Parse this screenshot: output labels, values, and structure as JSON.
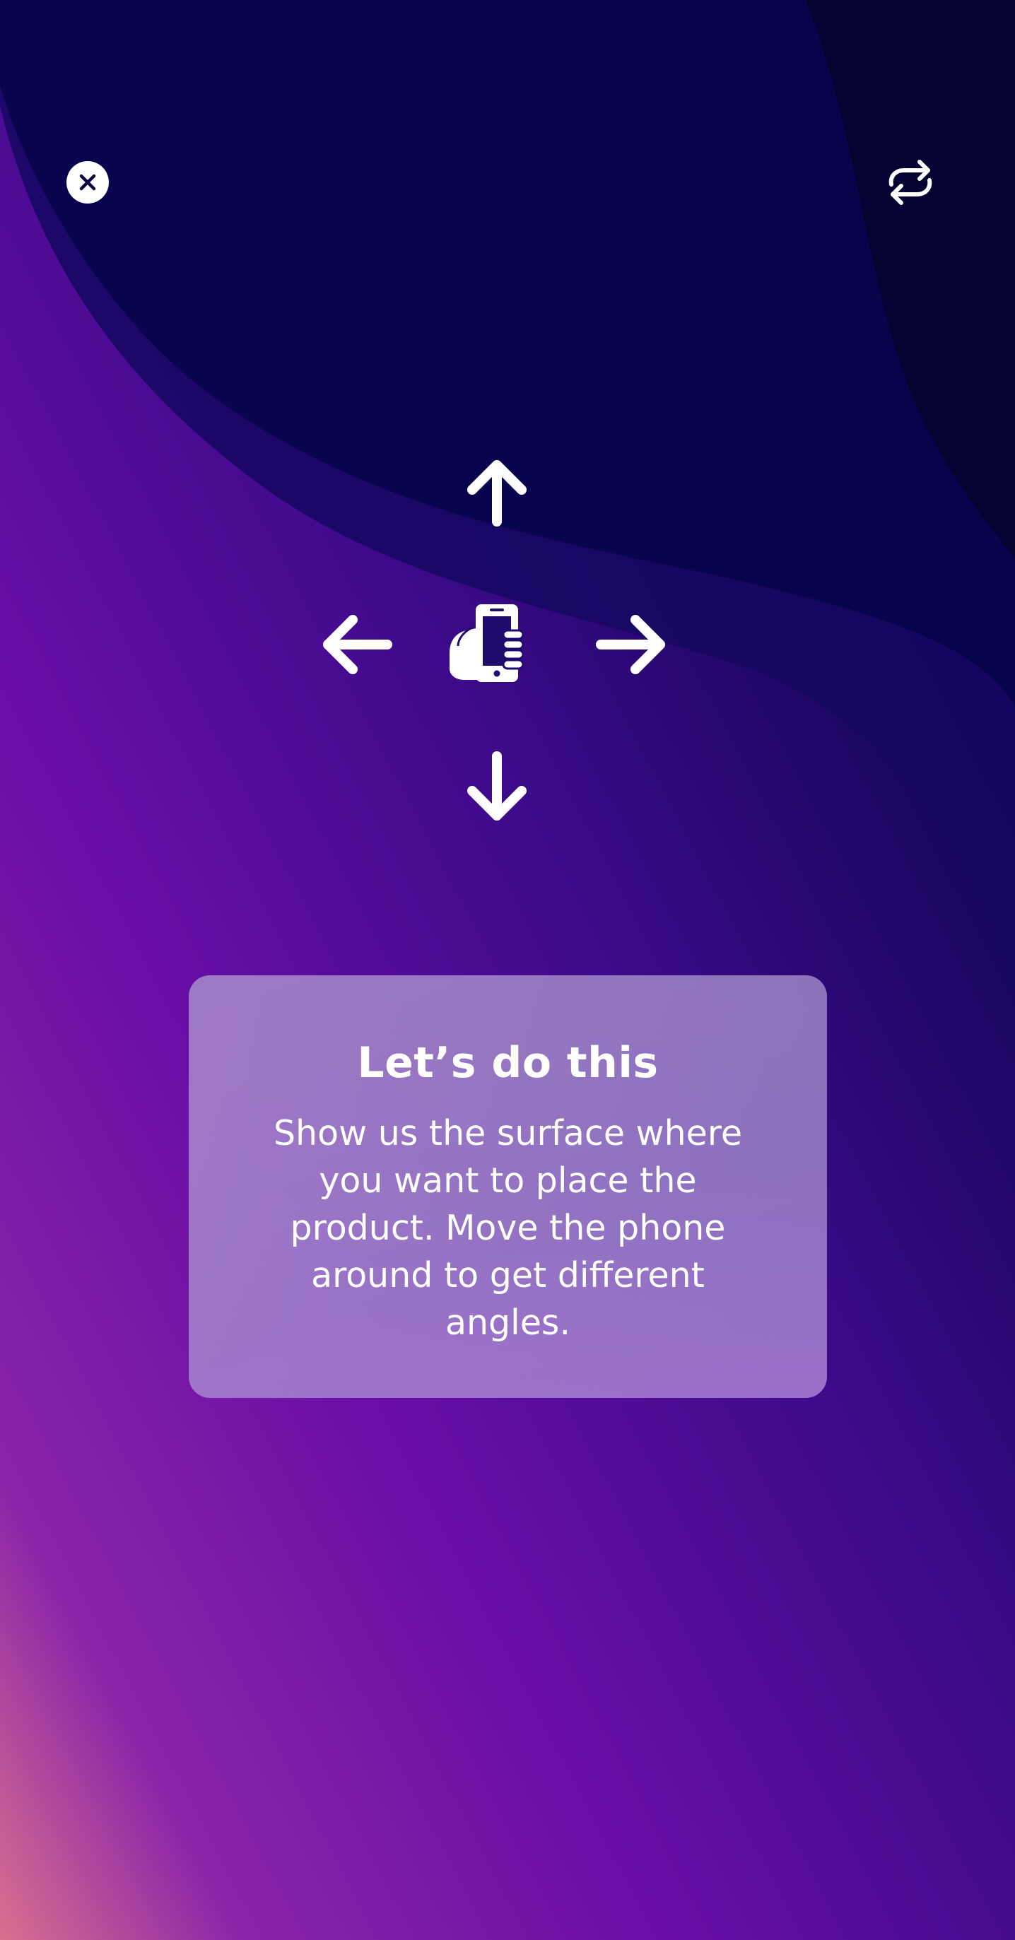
{
  "screen": {
    "colors": {
      "background_dark": "#01013f",
      "background_purple": "#5a0aa0",
      "background_pink": "#d7708f",
      "card_overlay": "#a88fcf",
      "text": "#ffffff"
    }
  },
  "header": {
    "close_icon": "close-icon",
    "refresh_icon": "refresh-icon"
  },
  "instruction_graphic": {
    "icons": [
      "arrow-up-icon",
      "arrow-left-icon",
      "hand-holding-phone-icon",
      "arrow-right-icon",
      "arrow-down-icon"
    ]
  },
  "card": {
    "title": "Let’s do this",
    "body": "Show us the surface where you want to place the product. Move the phone around to get different angles."
  }
}
